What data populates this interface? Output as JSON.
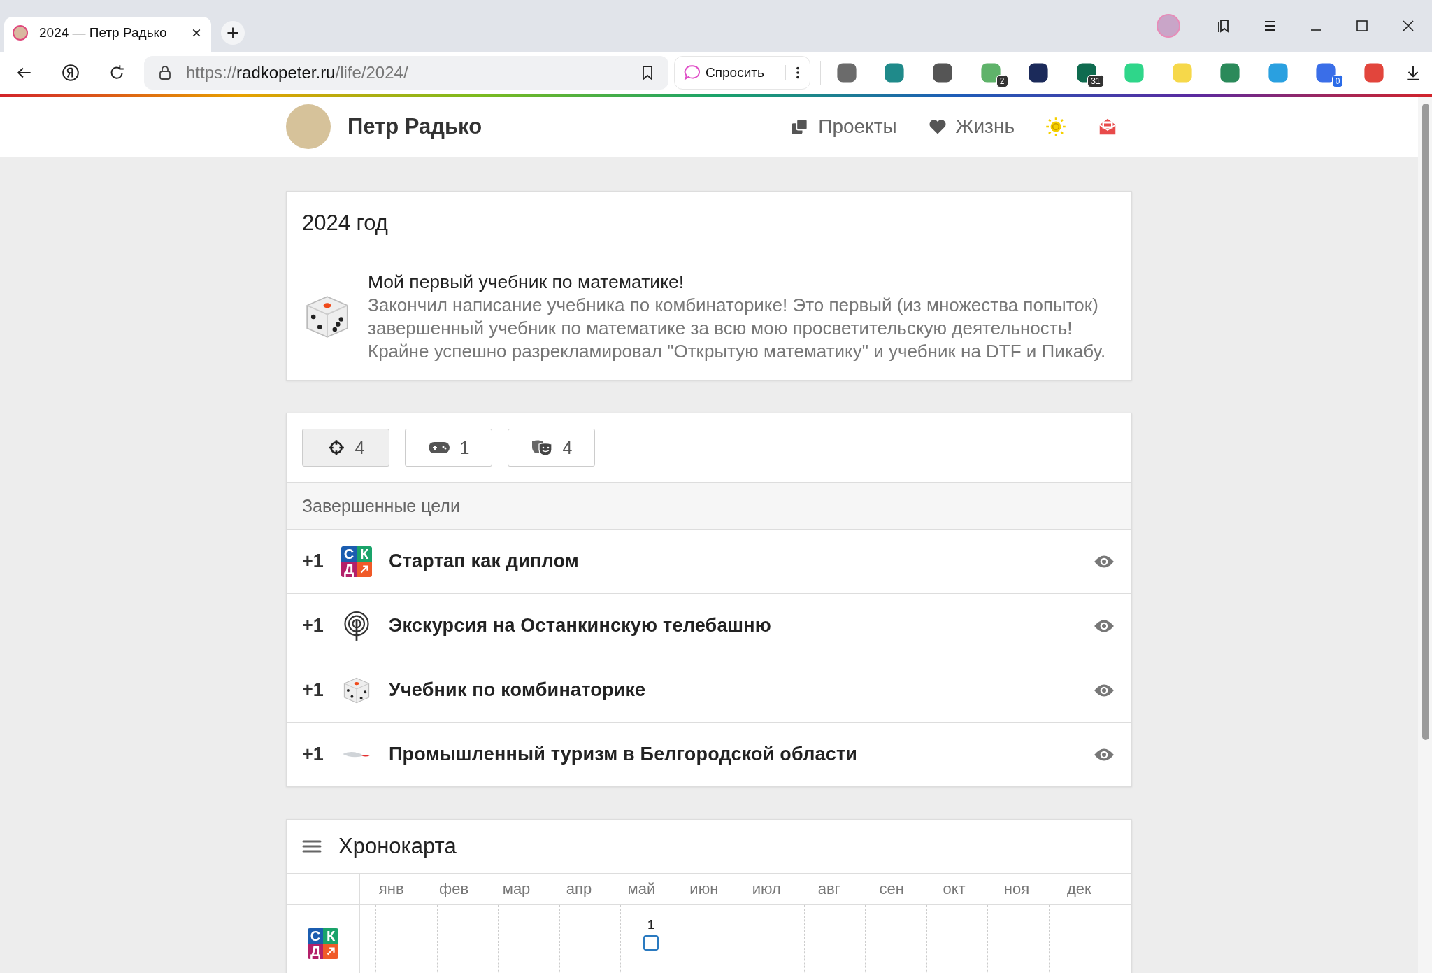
{
  "browser": {
    "tab": {
      "title": "2024 — Петр Радько"
    },
    "address": {
      "scheme": "https://",
      "host": "radkopeter.ru",
      "path": "/life/2024/"
    },
    "ask_button": "Спросить",
    "extensions": [
      {
        "kind": "mail"
      },
      {
        "kind": "tile"
      },
      {
        "kind": "cloud"
      },
      {
        "kind": "shield",
        "badge": "2"
      },
      {
        "kind": "image"
      },
      {
        "kind": "hexagon",
        "badge": "31"
      },
      {
        "kind": "key"
      },
      {
        "kind": "percent"
      },
      {
        "kind": "crest"
      },
      {
        "kind": "plane"
      },
      {
        "kind": "ring",
        "badge": "0"
      },
      {
        "kind": "lock"
      }
    ]
  },
  "site": {
    "name": "Петр Радько",
    "nav": [
      {
        "label": "Проекты"
      },
      {
        "label": "Жизнь"
      }
    ]
  },
  "post": {
    "title": "2024 год",
    "heading": "Мой первый учебник по математике!",
    "text": "Закончил написание учебника по комбинаторике! Это первый (из множества попыток) завершенный учебник по математике за всю мою просветительскую деятельность! Крайне успешно разрекламировал \"Открытую математику\" и учебник на DTF и Пикабу."
  },
  "filters": [
    {
      "count": "4",
      "selected": true
    },
    {
      "count": "1",
      "selected": false
    },
    {
      "count": "4",
      "selected": false
    }
  ],
  "section_title": "Завершенные цели",
  "goals": [
    {
      "points": "+1",
      "kind": "logo",
      "logo": [
        "С",
        "К",
        "Д"
      ],
      "title": "Стартап как диплом"
    },
    {
      "points": "+1",
      "kind": "tower",
      "title": "Экскурсия на Останкинскую телебашню"
    },
    {
      "points": "+1",
      "kind": "dice",
      "title": "Учебник по комбинаторике"
    },
    {
      "points": "+1",
      "kind": "plane",
      "title": "Промышленный туризм в Белгородской области"
    }
  ],
  "chronomap": {
    "title": "Хронокарта",
    "months": [
      "янв",
      "фев",
      "мар",
      "апр",
      "май",
      "июн",
      "июл",
      "авг",
      "сен",
      "окт",
      "ноя",
      "дек"
    ],
    "rows": [
      {
        "logo": [
          "С",
          "К",
          "Д"
        ],
        "cells": [
          {},
          {},
          {},
          {},
          {
            "count": "1"
          },
          {},
          {},
          {},
          {},
          {},
          {},
          {}
        ]
      }
    ]
  }
}
